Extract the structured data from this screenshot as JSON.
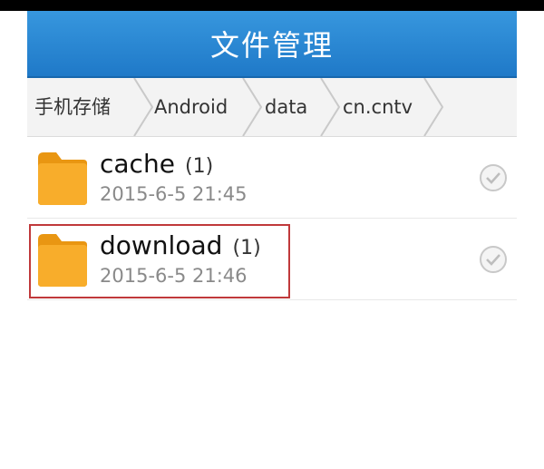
{
  "app": {
    "title": "文件管理"
  },
  "breadcrumb": [
    "手机存储",
    "Android",
    "data",
    "cn.cntv"
  ],
  "files": [
    {
      "name": "cache",
      "count": "(1)",
      "date": "2015-6-5 21:45"
    },
    {
      "name": "download",
      "count": "(1)",
      "date": "2015-6-5 21:46"
    }
  ],
  "colors": {
    "accent": "#2a88d6",
    "folder": "#f5a623",
    "highlight": "#c0393b"
  },
  "icons": [
    "folder-icon",
    "check-circle-icon",
    "chevron-separator-icon"
  ]
}
